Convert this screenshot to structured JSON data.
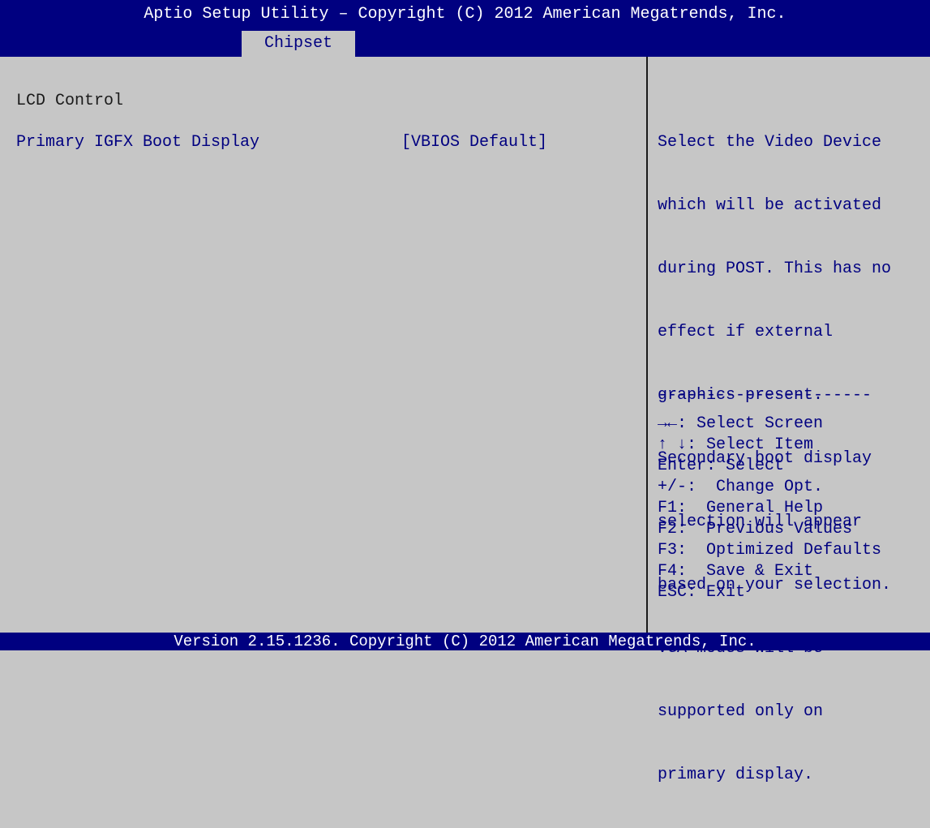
{
  "header": {
    "title": "Aptio Setup Utility – Copyright (C) 2012 American Megatrends, Inc.",
    "active_tab": "Chipset"
  },
  "main": {
    "section_title": "LCD Control",
    "options": [
      {
        "label": "Primary IGFX Boot Display",
        "value": "[VBIOS Default]"
      }
    ]
  },
  "help": {
    "lines": [
      "Select the Video Device",
      "which will be activated",
      "during POST. This has no",
      "effect if external",
      "graphics present.",
      "Secondary boot display",
      "selection will appear",
      "based on your selection.",
      "VGA modes will be",
      "supported only on",
      "primary display."
    ],
    "separator": "----------------------"
  },
  "keys": [
    {
      "key": "→←:",
      "action": " Select Screen"
    },
    {
      "key": "↑ ↓:",
      "action": " Select Item"
    },
    {
      "key": "Enter:",
      "action": " Select"
    },
    {
      "key": "+/-:",
      "action": "  Change Opt."
    },
    {
      "key": "F1:",
      "action": "  General Help"
    },
    {
      "key": "F2:",
      "action": "  Previous Values"
    },
    {
      "key": "F3:",
      "action": "  Optimized Defaults"
    },
    {
      "key": "F4:",
      "action": "  Save & Exit"
    },
    {
      "key": "ESC:",
      "action": " Exit"
    }
  ],
  "footer": {
    "text": "Version 2.15.1236. Copyright (C) 2012 American Megatrends, Inc."
  },
  "colors": {
    "bios_blue": "#000080",
    "panel_gray": "#c6c6c6",
    "text_dark": "#1a1a1a",
    "text_white": "#ffffff"
  }
}
